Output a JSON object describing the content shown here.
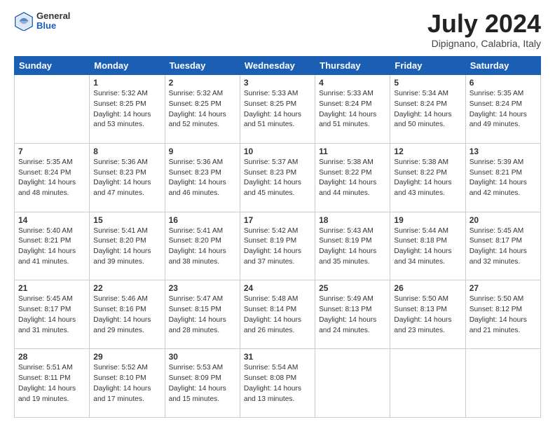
{
  "header": {
    "logo_general": "General",
    "logo_blue": "Blue",
    "month_year": "July 2024",
    "location": "Dipignano, Calabria, Italy"
  },
  "days_of_week": [
    "Sunday",
    "Monday",
    "Tuesday",
    "Wednesday",
    "Thursday",
    "Friday",
    "Saturday"
  ],
  "weeks": [
    [
      {
        "day": "",
        "info": ""
      },
      {
        "day": "1",
        "info": "Sunrise: 5:32 AM\nSunset: 8:25 PM\nDaylight: 14 hours\nand 53 minutes."
      },
      {
        "day": "2",
        "info": "Sunrise: 5:32 AM\nSunset: 8:25 PM\nDaylight: 14 hours\nand 52 minutes."
      },
      {
        "day": "3",
        "info": "Sunrise: 5:33 AM\nSunset: 8:25 PM\nDaylight: 14 hours\nand 51 minutes."
      },
      {
        "day": "4",
        "info": "Sunrise: 5:33 AM\nSunset: 8:24 PM\nDaylight: 14 hours\nand 51 minutes."
      },
      {
        "day": "5",
        "info": "Sunrise: 5:34 AM\nSunset: 8:24 PM\nDaylight: 14 hours\nand 50 minutes."
      },
      {
        "day": "6",
        "info": "Sunrise: 5:35 AM\nSunset: 8:24 PM\nDaylight: 14 hours\nand 49 minutes."
      }
    ],
    [
      {
        "day": "7",
        "info": "Sunrise: 5:35 AM\nSunset: 8:24 PM\nDaylight: 14 hours\nand 48 minutes."
      },
      {
        "day": "8",
        "info": "Sunrise: 5:36 AM\nSunset: 8:23 PM\nDaylight: 14 hours\nand 47 minutes."
      },
      {
        "day": "9",
        "info": "Sunrise: 5:36 AM\nSunset: 8:23 PM\nDaylight: 14 hours\nand 46 minutes."
      },
      {
        "day": "10",
        "info": "Sunrise: 5:37 AM\nSunset: 8:23 PM\nDaylight: 14 hours\nand 45 minutes."
      },
      {
        "day": "11",
        "info": "Sunrise: 5:38 AM\nSunset: 8:22 PM\nDaylight: 14 hours\nand 44 minutes."
      },
      {
        "day": "12",
        "info": "Sunrise: 5:38 AM\nSunset: 8:22 PM\nDaylight: 14 hours\nand 43 minutes."
      },
      {
        "day": "13",
        "info": "Sunrise: 5:39 AM\nSunset: 8:21 PM\nDaylight: 14 hours\nand 42 minutes."
      }
    ],
    [
      {
        "day": "14",
        "info": "Sunrise: 5:40 AM\nSunset: 8:21 PM\nDaylight: 14 hours\nand 41 minutes."
      },
      {
        "day": "15",
        "info": "Sunrise: 5:41 AM\nSunset: 8:20 PM\nDaylight: 14 hours\nand 39 minutes."
      },
      {
        "day": "16",
        "info": "Sunrise: 5:41 AM\nSunset: 8:20 PM\nDaylight: 14 hours\nand 38 minutes."
      },
      {
        "day": "17",
        "info": "Sunrise: 5:42 AM\nSunset: 8:19 PM\nDaylight: 14 hours\nand 37 minutes."
      },
      {
        "day": "18",
        "info": "Sunrise: 5:43 AM\nSunset: 8:19 PM\nDaylight: 14 hours\nand 35 minutes."
      },
      {
        "day": "19",
        "info": "Sunrise: 5:44 AM\nSunset: 8:18 PM\nDaylight: 14 hours\nand 34 minutes."
      },
      {
        "day": "20",
        "info": "Sunrise: 5:45 AM\nSunset: 8:17 PM\nDaylight: 14 hours\nand 32 minutes."
      }
    ],
    [
      {
        "day": "21",
        "info": "Sunrise: 5:45 AM\nSunset: 8:17 PM\nDaylight: 14 hours\nand 31 minutes."
      },
      {
        "day": "22",
        "info": "Sunrise: 5:46 AM\nSunset: 8:16 PM\nDaylight: 14 hours\nand 29 minutes."
      },
      {
        "day": "23",
        "info": "Sunrise: 5:47 AM\nSunset: 8:15 PM\nDaylight: 14 hours\nand 28 minutes."
      },
      {
        "day": "24",
        "info": "Sunrise: 5:48 AM\nSunset: 8:14 PM\nDaylight: 14 hours\nand 26 minutes."
      },
      {
        "day": "25",
        "info": "Sunrise: 5:49 AM\nSunset: 8:13 PM\nDaylight: 14 hours\nand 24 minutes."
      },
      {
        "day": "26",
        "info": "Sunrise: 5:50 AM\nSunset: 8:13 PM\nDaylight: 14 hours\nand 23 minutes."
      },
      {
        "day": "27",
        "info": "Sunrise: 5:50 AM\nSunset: 8:12 PM\nDaylight: 14 hours\nand 21 minutes."
      }
    ],
    [
      {
        "day": "28",
        "info": "Sunrise: 5:51 AM\nSunset: 8:11 PM\nDaylight: 14 hours\nand 19 minutes."
      },
      {
        "day": "29",
        "info": "Sunrise: 5:52 AM\nSunset: 8:10 PM\nDaylight: 14 hours\nand 17 minutes."
      },
      {
        "day": "30",
        "info": "Sunrise: 5:53 AM\nSunset: 8:09 PM\nDaylight: 14 hours\nand 15 minutes."
      },
      {
        "day": "31",
        "info": "Sunrise: 5:54 AM\nSunset: 8:08 PM\nDaylight: 14 hours\nand 13 minutes."
      },
      {
        "day": "",
        "info": ""
      },
      {
        "day": "",
        "info": ""
      },
      {
        "day": "",
        "info": ""
      }
    ]
  ]
}
